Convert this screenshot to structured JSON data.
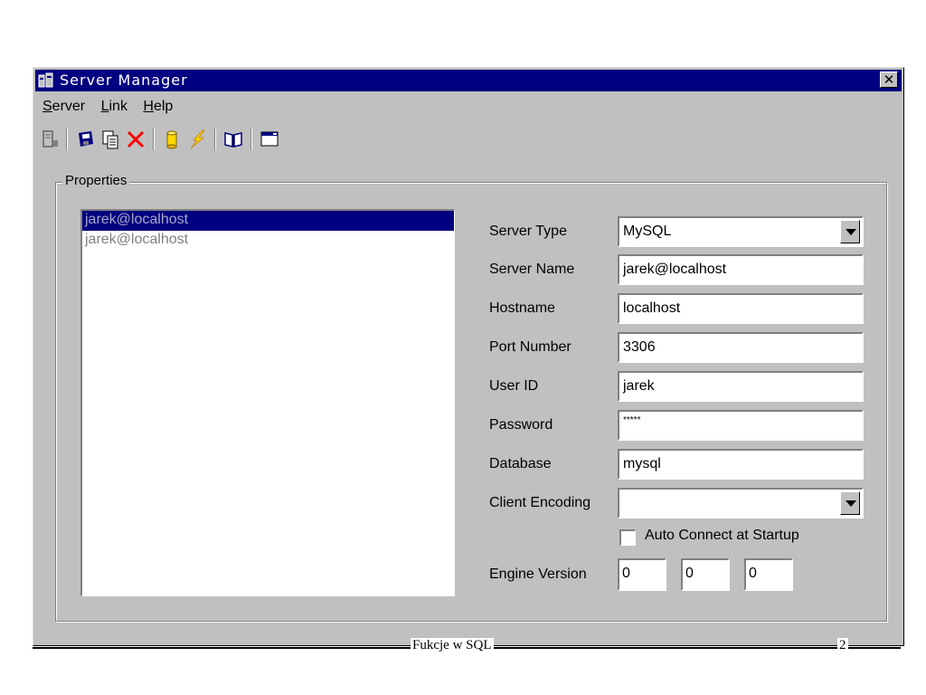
{
  "window": {
    "title": "Server Manager",
    "close_label": "✕"
  },
  "menu": [
    {
      "label": "erver",
      "accel": "S"
    },
    {
      "label": "ink",
      "accel": "L"
    },
    {
      "label": "elp",
      "accel": "H"
    }
  ],
  "toolbar": [
    "server-icon",
    "save-icon",
    "copy-icon",
    "delete-icon",
    "database-icon",
    "connect-icon",
    "book-icon",
    "window-icon"
  ],
  "colors": {
    "titlebar": "#000080",
    "face": "#c0c0c0",
    "selection": "#000080",
    "delete": "#ff0000"
  },
  "properties": {
    "group_label": "Properties",
    "servers": [
      "jarek@localhost",
      "jarek@localhost"
    ],
    "labels": {
      "server_type": "Server Type",
      "server_name": "Server Name",
      "hostname": "Hostname",
      "port": "Port Number",
      "user_id": "User ID",
      "password": "Password",
      "database": "Database",
      "client_encoding": "Client Encoding",
      "engine_version": "Engine Version"
    },
    "values": {
      "server_type": "MySQL",
      "server_name": "jarek@localhost",
      "hostname": "localhost",
      "port": "3306",
      "user_id": "jarek",
      "password": "*****",
      "database": "mysql",
      "client_encoding": "",
      "engine_version": [
        "0",
        "0",
        "0"
      ]
    },
    "auto_connect_label": "Auto Connect at Startup",
    "auto_connect_checked": false
  },
  "footer": {
    "text": "Fukcje w SQL",
    "page": "2"
  }
}
